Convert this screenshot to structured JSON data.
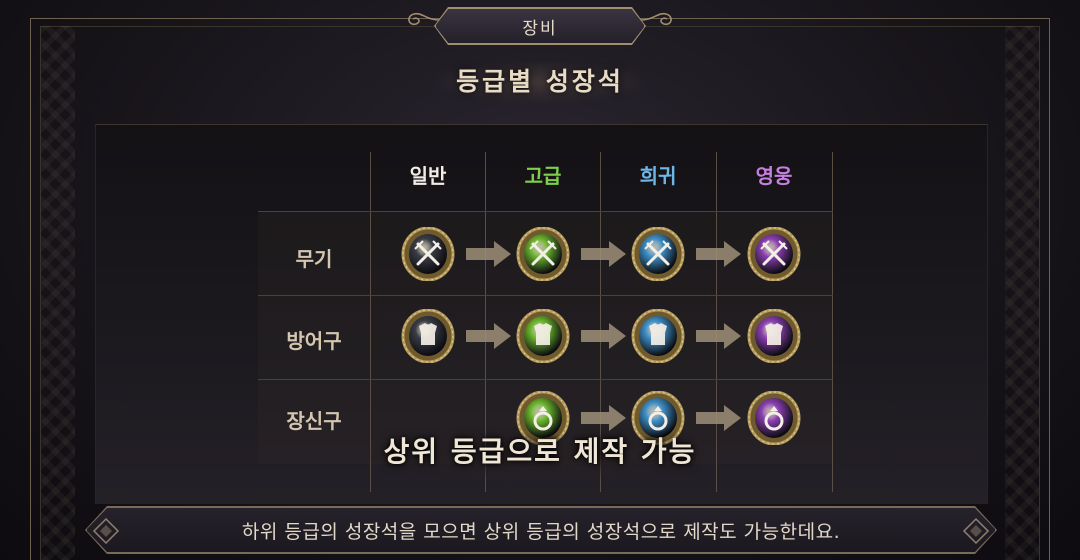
{
  "header": {
    "title": "장비"
  },
  "subtitle": "등급별 성장석",
  "grades": [
    {
      "label": "일반",
      "color": "#f2ede6"
    },
    {
      "label": "고급",
      "color": "#7ed04a"
    },
    {
      "label": "희귀",
      "color": "#6fb6e8"
    },
    {
      "label": "영웅",
      "color": "#c77fe0"
    }
  ],
  "rows": [
    {
      "label": "무기",
      "icon": "crossed-swords-gem-icon"
    },
    {
      "label": "방어구",
      "icon": "armor-gem-icon"
    },
    {
      "label": "장신구",
      "icon": "ring-gem-icon"
    }
  ],
  "overlay_text": "상위 등급으로 제작 가능",
  "caption": "하위 등급의 성장석을 모으면 상위 등급의 성장석으로 제작도 가능한데요.",
  "colors": {
    "gold_rim": "#b49a5c",
    "arrow": "#9d8f78",
    "gem_normal": "#3a3d45",
    "gem_advanced": "#6ab52c",
    "gem_rare": "#3f8fc7",
    "gem_heroic": "#8a3fb0"
  }
}
